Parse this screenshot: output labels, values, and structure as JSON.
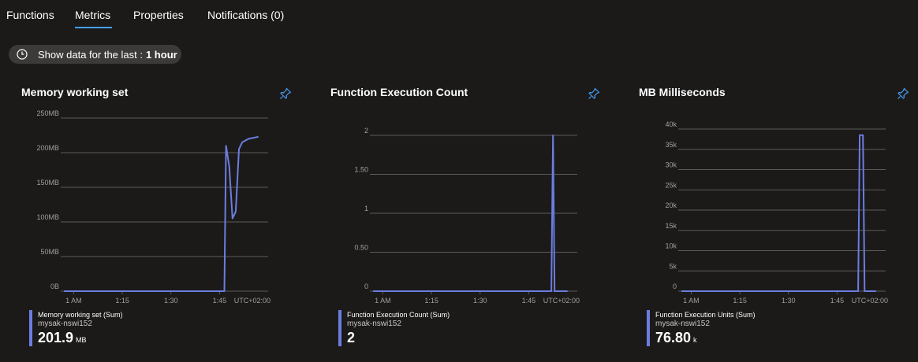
{
  "tabs": [
    {
      "label": "Functions"
    },
    {
      "label": "Metrics"
    },
    {
      "label": "Properties"
    },
    {
      "label": "Notifications (0)"
    }
  ],
  "time_filter": {
    "prefix": "Show data for the last :",
    "value": "1 hour"
  },
  "colors": {
    "series": "#6c7de0",
    "accent": "#479ef5",
    "grid": "#5c5b5a",
    "background": "#1b1a19"
  },
  "icons": {
    "clock": "clock-icon",
    "pin": "pin-icon"
  },
  "chart_data": [
    {
      "type": "line",
      "title": "Memory working set",
      "ylabels": [
        "250MB",
        "200MB",
        "150MB",
        "100MB",
        "50MB",
        "0B"
      ],
      "yticks": [
        250,
        200,
        150,
        100,
        50,
        0
      ],
      "ylim": [
        0,
        250
      ],
      "xlabels": [
        "1 AM",
        "1:15",
        "1:30",
        "1:45"
      ],
      "xticks": [
        0,
        15,
        30,
        45
      ],
      "xlim": [
        -4,
        60
      ],
      "timezone": "UTC+02:00",
      "grid": true,
      "series": [
        {
          "name": "Memory working set (Sum)",
          "resource": "mysak-nswi152",
          "x": [
            -3,
            46.5,
            47,
            48,
            49,
            50,
            51,
            52,
            54,
            57
          ],
          "y": [
            0,
            0,
            210,
            180,
            105,
            115,
            205,
            215,
            220,
            223
          ]
        }
      ],
      "summary": {
        "value": "201.9",
        "unit": "MB"
      }
    },
    {
      "type": "line",
      "title": "Function Execution Count",
      "ylabels": [
        "2",
        "1.50",
        "1",
        "0.50",
        "0"
      ],
      "yticks": [
        2,
        1.5,
        1,
        0.5,
        0
      ],
      "ylim": [
        0,
        2
      ],
      "xlabels": [
        "1 AM",
        "1:15",
        "1:30",
        "1:45"
      ],
      "xticks": [
        0,
        15,
        30,
        45
      ],
      "xlim": [
        -4,
        60
      ],
      "timezone": "UTC+02:00",
      "grid": true,
      "series": [
        {
          "name": "Function Execution Count (Sum)",
          "resource": "mysak-nswi152",
          "x": [
            -3,
            52,
            52.5,
            53,
            57
          ],
          "y": [
            0,
            0,
            2,
            0,
            0
          ]
        }
      ],
      "summary": {
        "value": "2",
        "unit": ""
      }
    },
    {
      "type": "line",
      "title": "MB Milliseconds",
      "ylabels": [
        "40k",
        "35k",
        "30k",
        "25k",
        "20k",
        "15k",
        "10k",
        "5k",
        "0"
      ],
      "yticks": [
        40000,
        35000,
        30000,
        25000,
        20000,
        15000,
        10000,
        5000,
        0
      ],
      "ylim": [
        0,
        40000
      ],
      "xlabels": [
        "1 AM",
        "1:15",
        "1:30",
        "1:45"
      ],
      "xticks": [
        0,
        15,
        30,
        45
      ],
      "xlim": [
        -4,
        60
      ],
      "timezone": "UTC+02:00",
      "grid": true,
      "series": [
        {
          "name": "Function Execution Units (Sum)",
          "resource": "mysak-nswi152",
          "x": [
            -3,
            51.5,
            52,
            53,
            53.5,
            57
          ],
          "y": [
            0,
            0,
            38500,
            38500,
            0,
            0
          ]
        }
      ],
      "summary": {
        "value": "76.80",
        "unit": "k"
      }
    }
  ]
}
